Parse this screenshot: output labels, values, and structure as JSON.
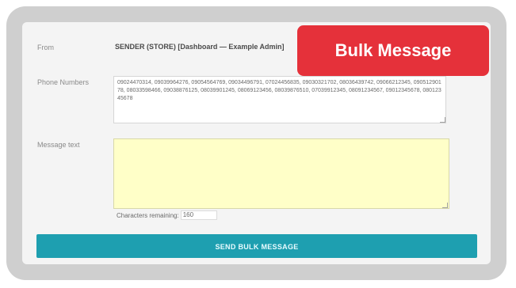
{
  "form": {
    "from_label": "From",
    "from_value": "SENDER (STORE) [Dashboard — Example Admin]",
    "phone_numbers_label": "Phone Numbers",
    "phone_numbers_value": "09024470314, 09039964276, 09054564769, 09034496791, 07024456835, 09030321702, 08036439742, 09066212345, 09051290178, 08033598466, 09038876125, 08039901245, 08069123456, 08039876510, 07039912345, 08091234567, 09012345678, 08012345678",
    "message_label": "Message text",
    "message_value": "",
    "chars_remaining_label": "Characters remaining:",
    "chars_remaining_value": "160",
    "send_button_label": "SEND BULK MESSAGE"
  },
  "badge": {
    "text": "Bulk Message",
    "color": "#e5313a"
  },
  "colors": {
    "send_button": "#1e9fb0",
    "message_background": "#ffffc8",
    "frame": "#cfcfcf"
  }
}
